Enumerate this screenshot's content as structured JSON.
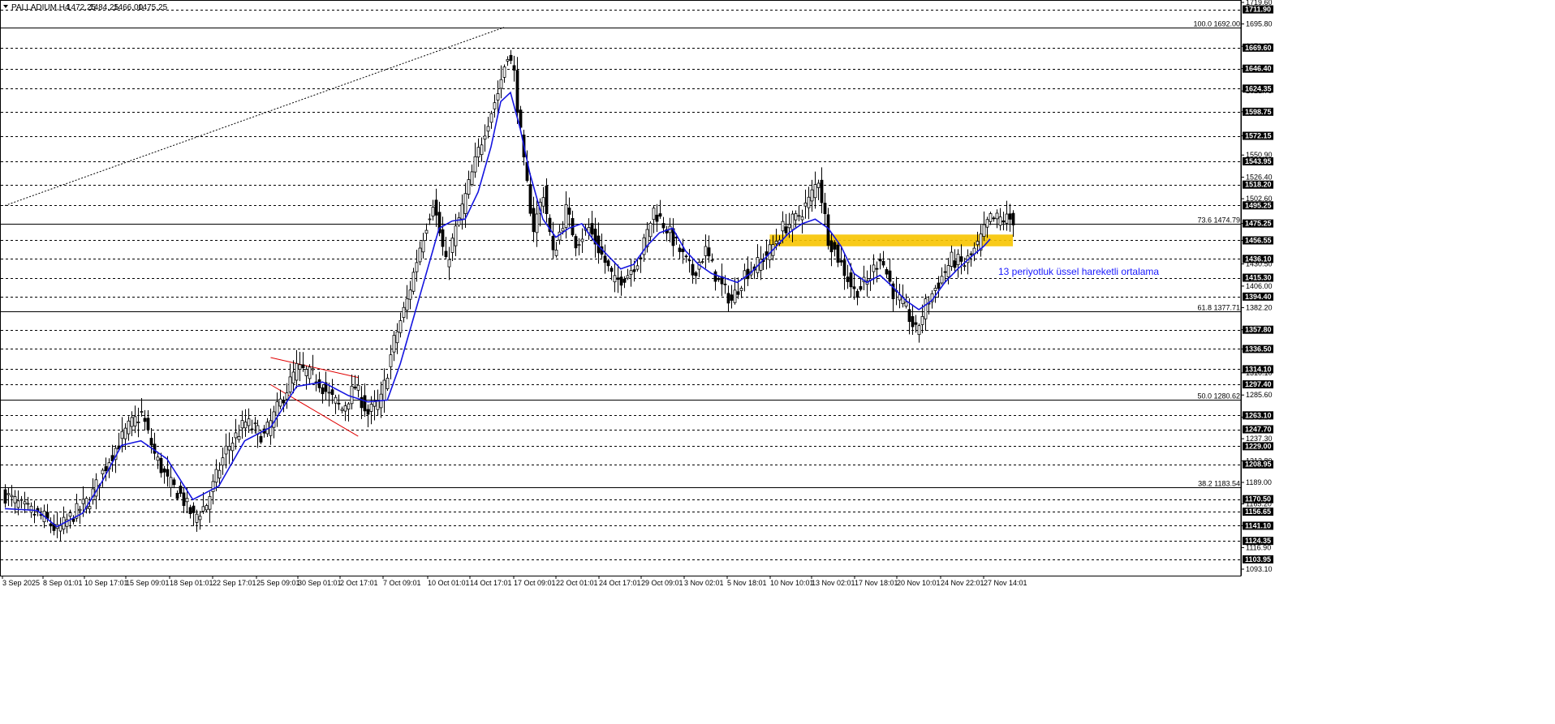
{
  "chart_data": {
    "type": "candlestick",
    "symbol": "PALLADIUM,H4",
    "ohlc": [
      "1472.25",
      "1484.25",
      "1466.00",
      "1475.25"
    ],
    "ylim": [
      1093.1,
      1719.6
    ],
    "y_ticks": [
      "1719.60",
      "1695.80",
      "1671.05",
      "1646.40",
      "1621.75",
      "1598.75",
      "1572.15",
      "1550.90",
      "1526.40",
      "1502.60",
      "1475.25",
      "1456.55",
      "1430.50",
      "1406.00",
      "1382.20",
      "1357.80",
      "1336.50",
      "1310.10",
      "1285.60",
      "1261.10",
      "1237.30",
      "1212.80",
      "1189.00",
      "1165.20",
      "1141.10",
      "1116.90",
      "1093.10"
    ],
    "x_ticks": [
      "3 Sep 2025",
      "8 Sep 01:01",
      "10 Sep 17:01",
      "15 Sep 09:01",
      "18 Sep 01:01",
      "22 Sep 17:01",
      "25 Sep 09:01",
      "30 Sep 01:01",
      "2 Oct 17:01",
      "7 Oct 09:01",
      "10 Oct 01:01",
      "14 Oct 17:01",
      "17 Oct 09:01",
      "22 Oct 01:01",
      "24 Oct 17:01",
      "29 Oct 09:01",
      "3 Nov 02:01",
      "5 Nov 18:01",
      "10 Nov 10:01",
      "13 Nov 02:01",
      "17 Nov 18:01",
      "20 Nov 10:01",
      "24 Nov 22:01",
      "27 Nov 14:01"
    ],
    "horizontal_levels": [
      1711.9,
      1669.6,
      1646.4,
      1624.35,
      1598.75,
      1572.15,
      1543.95,
      1518.2,
      1495.25,
      1475.25,
      1456.55,
      1436.1,
      1415.3,
      1394.4,
      1357.8,
      1336.5,
      1314.1,
      1297.4,
      1263.1,
      1247.7,
      1229.0,
      1208.95,
      1170.5,
      1156.65,
      1141.1,
      1124.35,
      1103.95
    ],
    "highlighted_prices": [
      "1711.90",
      "1669.60",
      "1646.40",
      "1624.35",
      "1598.75",
      "1572.15",
      "1543.95",
      "1518.20",
      "1495.25",
      "1475.25",
      "1456.55",
      "1436.10",
      "1415.30",
      "1394.40",
      "1357.80",
      "1336.50",
      "1314.10",
      "1297.40",
      "1263.10",
      "1247.70",
      "1229.00",
      "1208.95",
      "1170.50",
      "1156.65",
      "1141.10",
      "1124.35",
      "1103.95"
    ],
    "fibonacci": [
      {
        "label": "100.0 1692.00",
        "value": 1692.0
      },
      {
        "label": "73.6 1474.79",
        "value": 1474.79
      },
      {
        "label": "61.8 1377.71",
        "value": 1377.71
      },
      {
        "label": "50.0 1280.62",
        "value": 1280.62
      },
      {
        "label": "38.2 1183.54",
        "value": 1183.54
      }
    ],
    "ema_annotation": "13 periyotluk üssel hareketli ortalama",
    "price_anchors": [
      [
        0,
        1175
      ],
      [
        6,
        1160
      ],
      [
        12,
        1150
      ],
      [
        16,
        1135
      ],
      [
        20,
        1150
      ],
      [
        26,
        1170
      ],
      [
        32,
        1215
      ],
      [
        38,
        1250
      ],
      [
        42,
        1265
      ],
      [
        46,
        1220
      ],
      [
        50,
        1190
      ],
      [
        54,
        1175
      ],
      [
        58,
        1150
      ],
      [
        62,
        1165
      ],
      [
        68,
        1225
      ],
      [
        74,
        1255
      ],
      [
        80,
        1240
      ],
      [
        86,
        1285
      ],
      [
        90,
        1315
      ],
      [
        96,
        1305
      ],
      [
        100,
        1285
      ],
      [
        104,
        1270
      ],
      [
        108,
        1295
      ],
      [
        112,
        1265
      ],
      [
        116,
        1280
      ],
      [
        120,
        1345
      ],
      [
        124,
        1390
      ],
      [
        128,
        1450
      ],
      [
        132,
        1500
      ],
      [
        136,
        1430
      ],
      [
        140,
        1480
      ],
      [
        144,
        1530
      ],
      [
        148,
        1580
      ],
      [
        152,
        1620
      ],
      [
        155,
        1665
      ],
      [
        157,
        1640
      ],
      [
        160,
        1540
      ],
      [
        163,
        1470
      ],
      [
        166,
        1510
      ],
      [
        169,
        1440
      ],
      [
        173,
        1490
      ],
      [
        176,
        1455
      ],
      [
        180,
        1470
      ],
      [
        184,
        1440
      ],
      [
        188,
        1410
      ],
      [
        192,
        1420
      ],
      [
        196,
        1440
      ],
      [
        200,
        1490
      ],
      [
        204,
        1470
      ],
      [
        208,
        1445
      ],
      [
        212,
        1420
      ],
      [
        216,
        1445
      ],
      [
        220,
        1410
      ],
      [
        224,
        1390
      ],
      [
        228,
        1420
      ],
      [
        232,
        1430
      ],
      [
        236,
        1445
      ],
      [
        240,
        1470
      ],
      [
        244,
        1480
      ],
      [
        248,
        1500
      ],
      [
        251,
        1525
      ],
      [
        254,
        1460
      ],
      [
        258,
        1430
      ],
      [
        262,
        1400
      ],
      [
        266,
        1410
      ],
      [
        270,
        1440
      ],
      [
        274,
        1400
      ],
      [
        278,
        1380
      ],
      [
        281,
        1355
      ],
      [
        284,
        1385
      ],
      [
        288,
        1410
      ],
      [
        292,
        1435
      ],
      [
        296,
        1430
      ],
      [
        300,
        1450
      ],
      [
        303,
        1475
      ],
      [
        304,
        1480
      ]
    ],
    "ema_anchors": [
      [
        0,
        1160
      ],
      [
        10,
        1158
      ],
      [
        16,
        1140
      ],
      [
        24,
        1155
      ],
      [
        30,
        1190
      ],
      [
        36,
        1230
      ],
      [
        42,
        1235
      ],
      [
        50,
        1215
      ],
      [
        58,
        1170
      ],
      [
        66,
        1185
      ],
      [
        74,
        1235
      ],
      [
        82,
        1250
      ],
      [
        90,
        1295
      ],
      [
        98,
        1300
      ],
      [
        106,
        1285
      ],
      [
        112,
        1278
      ],
      [
        118,
        1280
      ],
      [
        122,
        1320
      ],
      [
        126,
        1370
      ],
      [
        130,
        1420
      ],
      [
        134,
        1470
      ],
      [
        138,
        1478
      ],
      [
        142,
        1480
      ],
      [
        146,
        1510
      ],
      [
        150,
        1560
      ],
      [
        153,
        1610
      ],
      [
        156,
        1620
      ],
      [
        159,
        1580
      ],
      [
        162,
        1530
      ],
      [
        166,
        1480
      ],
      [
        170,
        1460
      ],
      [
        174,
        1470
      ],
      [
        178,
        1475
      ],
      [
        182,
        1455
      ],
      [
        186,
        1440
      ],
      [
        190,
        1425
      ],
      [
        194,
        1430
      ],
      [
        198,
        1450
      ],
      [
        202,
        1465
      ],
      [
        206,
        1470
      ],
      [
        210,
        1445
      ],
      [
        214,
        1430
      ],
      [
        218,
        1420
      ],
      [
        222,
        1415
      ],
      [
        226,
        1410
      ],
      [
        230,
        1420
      ],
      [
        234,
        1435
      ],
      [
        238,
        1450
      ],
      [
        242,
        1465
      ],
      [
        246,
        1475
      ],
      [
        250,
        1480
      ],
      [
        254,
        1470
      ],
      [
        258,
        1450
      ],
      [
        262,
        1420
      ],
      [
        266,
        1410
      ],
      [
        270,
        1418
      ],
      [
        274,
        1405
      ],
      [
        278,
        1390
      ],
      [
        282,
        1380
      ],
      [
        286,
        1390
      ],
      [
        290,
        1410
      ],
      [
        294,
        1425
      ],
      [
        298,
        1438
      ],
      [
        302,
        1450
      ],
      [
        304,
        1458
      ]
    ],
    "channel_lines": [
      [
        [
          82,
          1327
        ],
        [
          109,
          1305
        ]
      ],
      [
        [
          82,
          1297
        ],
        [
          109,
          1240
        ]
      ]
    ],
    "trend_line": [
      [
        0,
        1495
      ],
      [
        154,
        1692
      ]
    ],
    "zone": {
      "from": 1450,
      "to": 1463,
      "start": 236,
      "end": 311
    }
  }
}
